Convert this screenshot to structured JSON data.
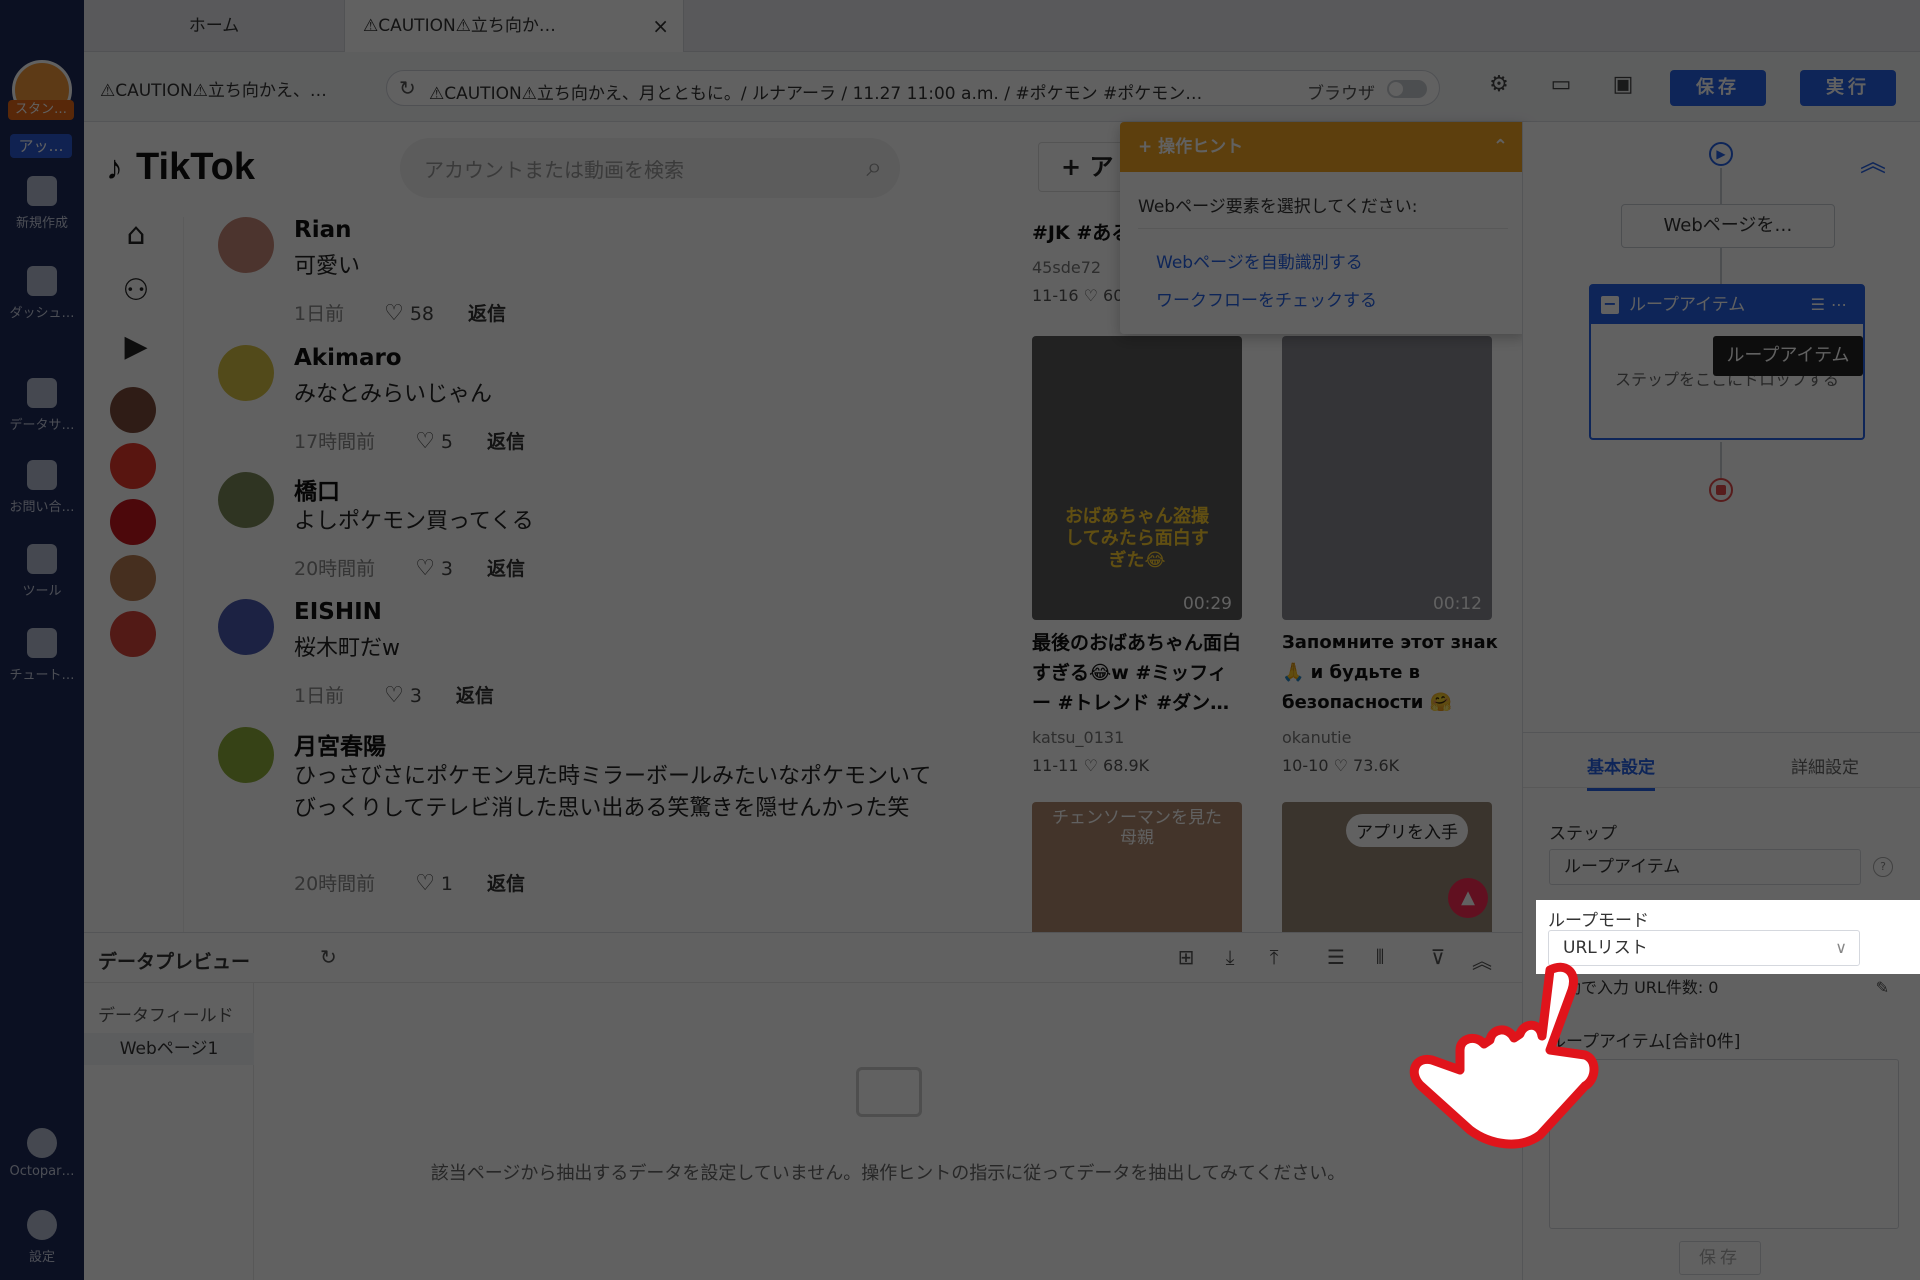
{
  "app": {
    "user_badge": "スタン…",
    "app_badge": "アッ…",
    "nav": [
      {
        "label": "新規作成",
        "icon": "plus-icon"
      },
      {
        "label": "ダッシュ…",
        "icon": "dashboard-icon"
      },
      {
        "label": "データサ…",
        "icon": "data-service-icon"
      },
      {
        "label": "お問い合…",
        "icon": "support-headset-icon"
      },
      {
        "label": "ツール",
        "icon": "toolbox-icon"
      },
      {
        "label": "チュート…",
        "icon": "tutorial-cap-icon"
      }
    ],
    "bottom_nav": [
      {
        "label": "Octopar…",
        "icon": "info-icon"
      },
      {
        "label": "設定",
        "icon": "gear-icon"
      }
    ]
  },
  "tabs": [
    {
      "label": "ホーム"
    },
    {
      "label": "⚠CAUTION⚠立ち向か…"
    }
  ],
  "toolbar": {
    "page_name": "⚠CAUTION⚠立ち向かえ、…",
    "url": "⚠CAUTION⚠立ち向かえ、月とともに。/ ルナアーラ / 11.27 11:00 a.m. / #ポケモン #ポケモン…",
    "browser_label": "ブラウザ",
    "save_label": "保存",
    "run_label": "実行"
  },
  "tiktok": {
    "logo": "TikTok",
    "search_placeholder": "アカウントまたは動画を検索",
    "upload_label": "+ ア",
    "comments": [
      {
        "name": "Rian",
        "text": "可愛い",
        "time": "1日前",
        "likes": "58",
        "reply": "返信"
      },
      {
        "name": "Akimaro",
        "text": "みなとみらいじゃん",
        "time": "17時間前",
        "likes": "5",
        "reply": "返信"
      },
      {
        "name": "橋口",
        "text": "よしポケモン買ってくる",
        "time": "20時間前",
        "likes": "3",
        "reply": "返信"
      },
      {
        "name": "EISHIN",
        "text": "桜木町だw",
        "time": "1日前",
        "likes": "3",
        "reply": "返信"
      },
      {
        "name": "月宮春陽",
        "text": "ひっさびさにポケモン見た時ミラーボールみたいなポケモンいてびっくりしてテレビ消した思い出ある笑驚きを隠せんかった笑",
        "time": "20時間前",
        "likes": "1",
        "reply": "返信"
      }
    ],
    "top_video": {
      "title": "#JK #ある",
      "author": "45sde72",
      "date": "11-16",
      "likes": "60"
    },
    "videos": [
      {
        "title": "最後のおばあちゃん面白すぎる😂w #ミッフィー #トレンド #ダン…",
        "author": "katsu_0131",
        "date": "11-11",
        "likes": "68.9K",
        "duration": "00:29",
        "caption": "おばあちゃん盗撮してみたら面白すぎた😂"
      },
      {
        "title": "Запомните этот знак 🙏 и будьте в безопасности 🤗",
        "author": "okanutie",
        "date": "10-10",
        "likes": "73.6K",
        "duration": "00:12",
        "caption": ""
      }
    ],
    "bottom_videos": [
      {
        "caption": "チェンソーマンを見た母親"
      },
      {
        "caption": "アプリを入手"
      }
    ]
  },
  "hint": {
    "title": "+ 操作ヒント",
    "instruction": "Webページ要素を選択してください:",
    "links": [
      "Webページを自動識別する",
      "ワークフローをチェックする"
    ]
  },
  "workflow": {
    "step1": "Webページを…",
    "loop_title": "ループアイテム",
    "loop_body": "ステップをここにドロップする",
    "tooltip": "ループアイテム"
  },
  "settings": {
    "tab_basic": "基本設定",
    "tab_advanced": "詳細設定",
    "step_label": "ステップ",
    "step_value": "ループアイテム",
    "loop_mode_label": "ループモード",
    "loop_mode_value": "URLリスト",
    "url_count": "手動で入力 URL件数: 0",
    "loop_items_label": "ループアイテム[合計0件]",
    "save_label": "保存"
  },
  "preview": {
    "title": "データプレビュー",
    "fields_label": "データフィールド",
    "page_label": "Webページ1",
    "empty_message": "該当ページから抽出するデータを設定していません。操作ヒントの指示に従ってデータを抽出してみてください。"
  }
}
